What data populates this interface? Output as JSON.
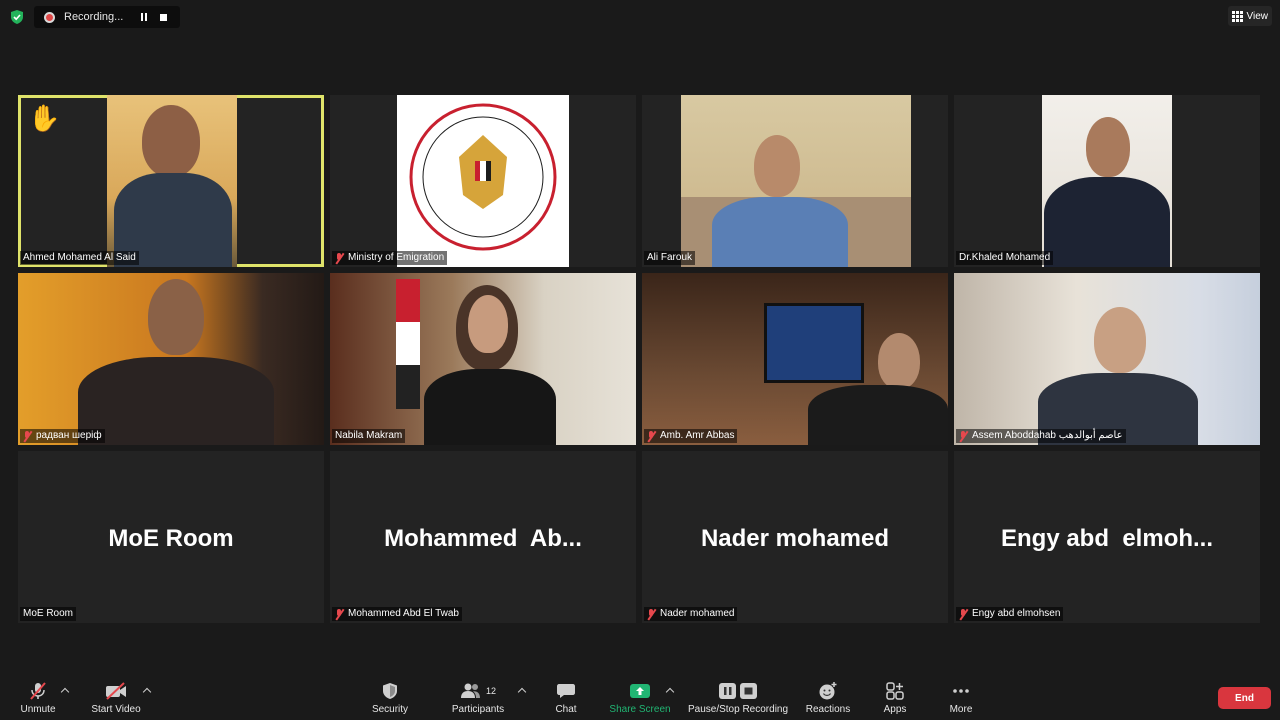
{
  "recording": {
    "status": "Recording..."
  },
  "view": {
    "label": "View"
  },
  "participants": [
    {
      "name": "Ahmed Mohamed Al Said",
      "muted": false,
      "active": true,
      "hand_raised": true
    },
    {
      "name": "Ministry of Emigration",
      "muted": true
    },
    {
      "name": "Ali Farouk",
      "muted": false
    },
    {
      "name": "Dr.Khaled Mohamed",
      "muted": false
    },
    {
      "name": "радван шеріф",
      "muted": true
    },
    {
      "name": "Nabila Makram",
      "muted": false
    },
    {
      "name": "Amb. Amr Abbas",
      "muted": true
    },
    {
      "name": "Assem Aboddahab عاصم أبوالدهب",
      "muted": true
    },
    {
      "name": "MoE Room",
      "display": "MoE Room",
      "muted": false
    },
    {
      "name": "Mohammed Abd El Twab",
      "display": "Mohammed  Ab...",
      "muted": true
    },
    {
      "name": "Nader mohamed",
      "display": "Nader mohamed",
      "muted": true
    },
    {
      "name": "Engy abd elmohsen",
      "display": "Engy abd  elmoh...",
      "muted": true
    }
  ],
  "toolbar": {
    "unmute": "Unmute",
    "start_video": "Start Video",
    "security": "Security",
    "participants": "Participants",
    "participants_count": "12",
    "chat": "Chat",
    "share_screen": "Share Screen",
    "pause_stop_recording": "Pause/Stop Recording",
    "reactions": "Reactions",
    "apps": "Apps",
    "more": "More",
    "end": "End"
  },
  "colors": {
    "background": "#1a1a1a",
    "tile": "#232323",
    "active_speaker": "#dfe36a",
    "muted": "#e5484d",
    "share_screen": "#21b573",
    "end": "#d9363e"
  }
}
